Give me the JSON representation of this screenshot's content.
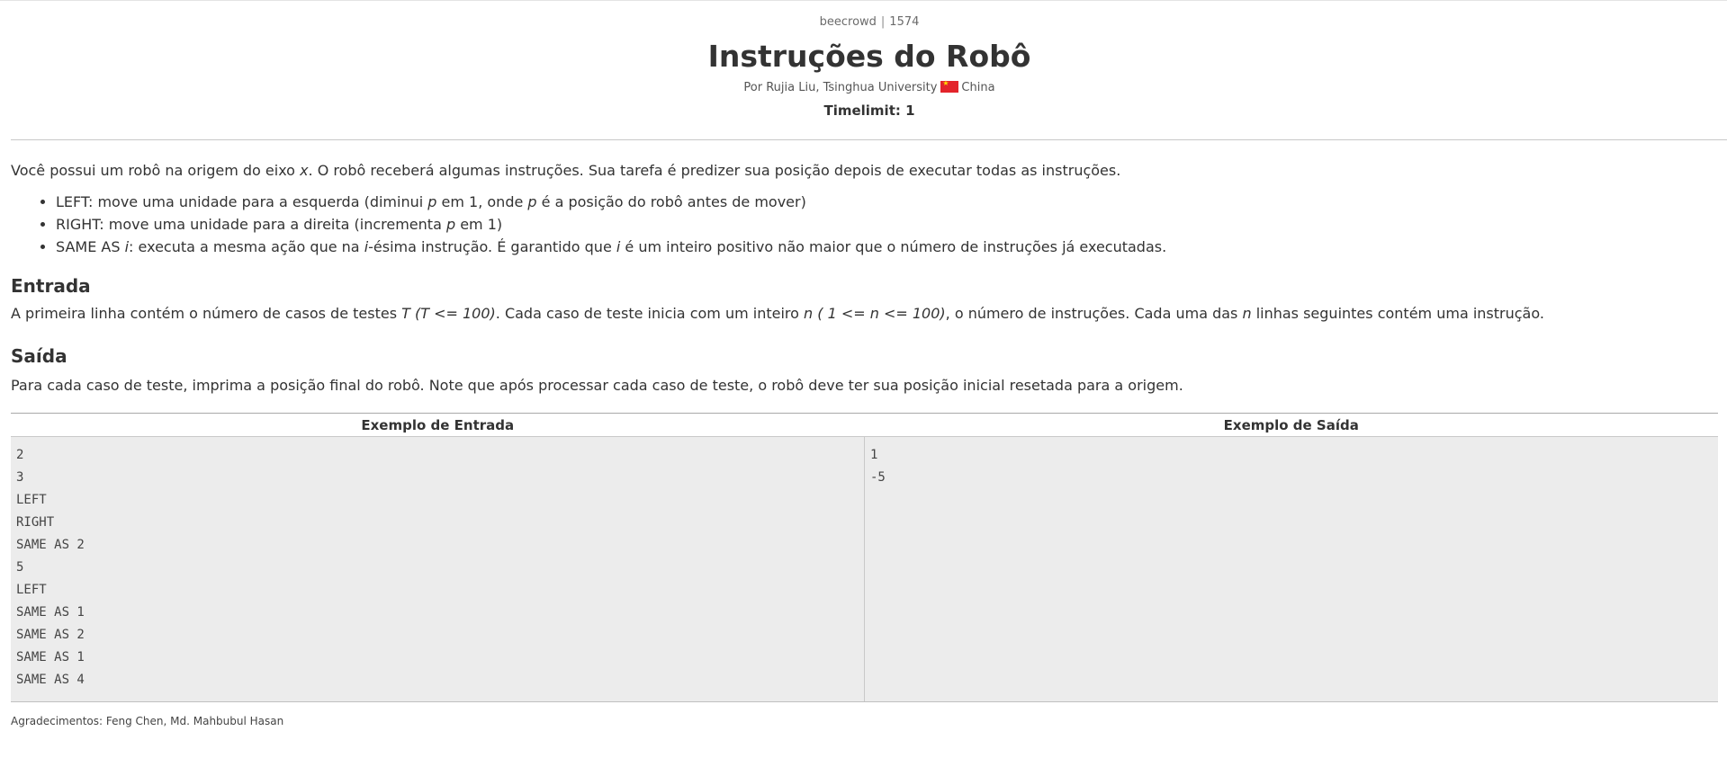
{
  "breadcrumb": {
    "site": "beecrowd",
    "separator": "|",
    "problem_id": "1574"
  },
  "title": "Instruções do Robô",
  "byline": {
    "prefix": "Por Rujia Liu, Tsinghua University",
    "country": "China"
  },
  "timelimit": "Timelimit: 1",
  "intro": {
    "part1": "Você possui um robô na origem do eixo ",
    "var": "x",
    "part2": ". O robô receberá algumas instruções. Sua tarefa é predizer sua posição depois de executar todas as instruções."
  },
  "rules": [
    {
      "a": "LEFT: move uma unidade para a esquerda (diminui ",
      "v1": "p",
      "b": " em 1, onde ",
      "v2": "p",
      "c": " é a posição do robô antes de mover)"
    },
    {
      "a": "RIGHT: move uma unidade para a direita (incrementa ",
      "v1": "p",
      "b": " em 1)"
    },
    {
      "a": "SAME AS ",
      "v1": "i",
      "b": ": executa a mesma ação que na ",
      "v2": "i",
      "c": "-ésima instrução. É garantido que ",
      "v3": "i",
      "d": " é um inteiro positivo não maior que o número de instruções já executadas."
    }
  ],
  "input_section": {
    "heading": "Entrada",
    "a": "A primeira linha contém o número de casos de testes ",
    "v1": "T (T <= 100)",
    "b": ". Cada caso de teste inicia com um inteiro ",
    "v2": "n ( 1 <= n <= 100)",
    "c": ", o número de instruções. Cada uma das ",
    "v3": "n",
    "d": " linhas seguintes contém uma instrução."
  },
  "output_section": {
    "heading": "Saída",
    "text": "Para cada caso de teste, imprima a posição final do robô. Note que após processar cada caso de teste, o robô deve ter sua posição inicial resetada para a origem."
  },
  "samples": {
    "input_header": "Exemplo de Entrada",
    "output_header": "Exemplo de Saída",
    "input": "2\n3\nLEFT\nRIGHT\nSAME AS 2\n5\nLEFT\nSAME AS 1\nSAME AS 2\nSAME AS 1\nSAME AS 4",
    "output": "1\n-5"
  },
  "credits": "Agradecimentos: Feng Chen, Md. Mahbubul Hasan",
  "colors": {
    "flag_red": "#e3242b",
    "flag_star": "#ffde00",
    "sample_bg": "#ececec"
  }
}
